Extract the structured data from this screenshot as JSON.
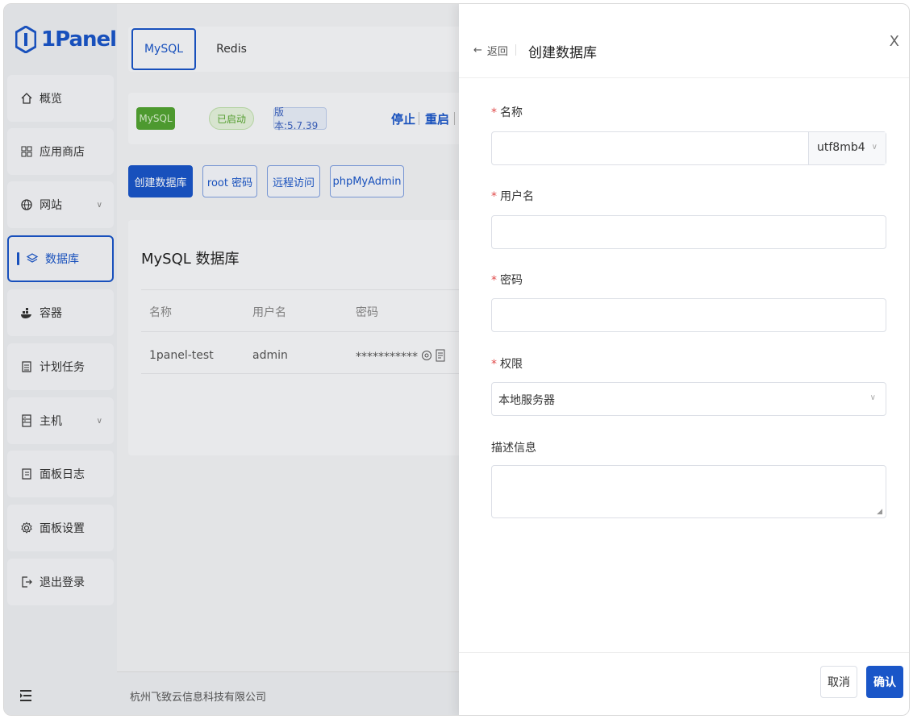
{
  "app": {
    "brand": "1Panel",
    "brand_color": "#1a56c8"
  },
  "sidebar": {
    "items": [
      {
        "label": "概览",
        "icon": "home-icon"
      },
      {
        "label": "应用商店",
        "icon": "grid-icon"
      },
      {
        "label": "网站",
        "icon": "globe-icon",
        "expandable": true
      },
      {
        "label": "数据库",
        "icon": "layers-icon",
        "active": true
      },
      {
        "label": "容器",
        "icon": "docker-icon"
      },
      {
        "label": "计划任务",
        "icon": "calendar-icon"
      },
      {
        "label": "主机",
        "icon": "server-icon",
        "expandable": true
      },
      {
        "label": "面板日志",
        "icon": "log-icon"
      },
      {
        "label": "面板设置",
        "icon": "gear-icon"
      },
      {
        "label": "退出登录",
        "icon": "logout-icon"
      }
    ]
  },
  "main": {
    "tabs": [
      "MySQL",
      "Redis"
    ],
    "status": {
      "app": "MySQL",
      "state": "已启动",
      "version": "版本:5.7.39",
      "stop": "停止",
      "restart": "重启"
    },
    "buttons": {
      "create": "创建数据库",
      "root_password": "root 密码",
      "remote_access": "远程访问",
      "phpmyadmin": "phpMyAdmin"
    },
    "card": {
      "title": "MySQL 数据库",
      "columns": [
        "名称",
        "用户名",
        "密码"
      ],
      "rows": [
        {
          "name": "1panel-test",
          "username": "admin",
          "password": "***********"
        }
      ]
    },
    "footer": "杭州飞致云信息科技有限公司"
  },
  "drawer": {
    "back": "返回",
    "title": "创建数据库",
    "close": "X",
    "fields": {
      "name_label": "名称",
      "name_value": "",
      "charset": "utf8mb4",
      "username_label": "用户名",
      "username_value": "",
      "password_label": "密码",
      "password_value": "",
      "permission_label": "权限",
      "permission_value": "本地服务器",
      "description_label": "描述信息",
      "description_value": ""
    },
    "cancel": "取消",
    "confirm": "确认"
  }
}
